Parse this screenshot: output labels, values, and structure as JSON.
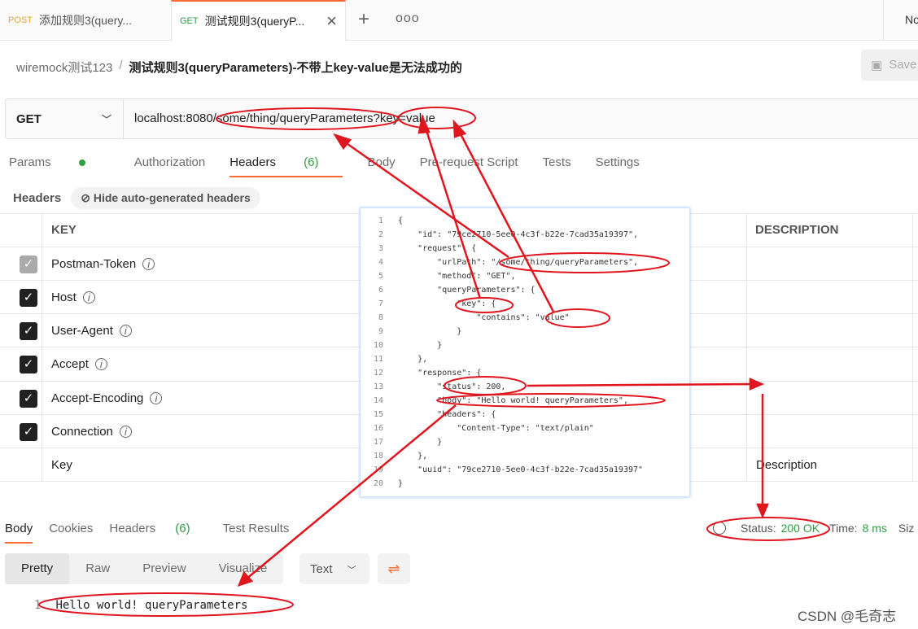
{
  "tabs": [
    {
      "method": "POST",
      "title": "添加规则3(query..."
    },
    {
      "method": "GET",
      "title": "测试规则3(queryP..."
    }
  ],
  "env_partial": "No",
  "breadcrumb": {
    "collection": "wiremock测试123",
    "separator": "/",
    "request": "测试规则3(queryParameters)-不带上key-value是无法成功的"
  },
  "save_label": "Save",
  "request": {
    "method": "GET",
    "url": "localhost:8080/some/thing/queryParameters?key=value"
  },
  "req_tabs": {
    "params": "Params",
    "authorization": "Authorization",
    "headers": "Headers",
    "headers_count": "(6)",
    "body": "Body",
    "prerequest": "Pre-request Script",
    "tests": "Tests",
    "settings": "Settings"
  },
  "headers_section": {
    "label": "Headers",
    "hide_auto": "Hide auto-generated headers"
  },
  "table": {
    "col_key": "KEY",
    "col_desc": "DESCRIPTION",
    "rows": [
      "Postman-Token",
      "Host",
      "User-Agent",
      "Accept",
      "Accept-Encoding",
      "Connection"
    ],
    "key_placeholder": "Key",
    "desc_placeholder": "Description"
  },
  "code_lines": [
    {
      "n": "1",
      "t": "{"
    },
    {
      "n": "2",
      "t": "    \"id\": \"79ce2710-5ee0-4c3f-b22e-7cad35a19397\","
    },
    {
      "n": "3",
      "t": "    \"request\": {"
    },
    {
      "n": "4",
      "t": "        \"urlPath\": \"/some/thing/queryParameters\","
    },
    {
      "n": "5",
      "t": "        \"method\": \"GET\","
    },
    {
      "n": "6",
      "t": "        \"queryParameters\": {"
    },
    {
      "n": "7",
      "t": "            \"key\": {"
    },
    {
      "n": "8",
      "t": "                \"contains\": \"value\""
    },
    {
      "n": "9",
      "t": "            }"
    },
    {
      "n": "10",
      "t": "        }"
    },
    {
      "n": "11",
      "t": "    },"
    },
    {
      "n": "12",
      "t": "    \"response\": {"
    },
    {
      "n": "13",
      "t": "        \"status\": 200,"
    },
    {
      "n": "14",
      "t": "        \"body\": \"Hello world! queryParameters\","
    },
    {
      "n": "15",
      "t": "        \"headers\": {"
    },
    {
      "n": "16",
      "t": "            \"Content-Type\": \"text/plain\""
    },
    {
      "n": "17",
      "t": "        }"
    },
    {
      "n": "18",
      "t": "    },"
    },
    {
      "n": "19",
      "t": "    \"uuid\": \"79ce2710-5ee0-4c3f-b22e-7cad35a19397\""
    },
    {
      "n": "20",
      "t": "}"
    }
  ],
  "resp_tabs": {
    "body": "Body",
    "cookies": "Cookies",
    "headers": "Headers",
    "headers_count": "(6)",
    "tests": "Test Results"
  },
  "status": {
    "label": "Status:",
    "value": "200 OK",
    "time_label": "Time:",
    "time": "8 ms",
    "size_partial": "Siz"
  },
  "formats": {
    "pretty": "Pretty",
    "raw": "Raw",
    "preview": "Preview",
    "visualize": "Visualize",
    "type": "Text"
  },
  "response_body": {
    "line": "1",
    "text": "Hello world! queryParameters"
  },
  "watermark": "CSDN @毛奇志",
  "annotation_color": "#e0151e"
}
